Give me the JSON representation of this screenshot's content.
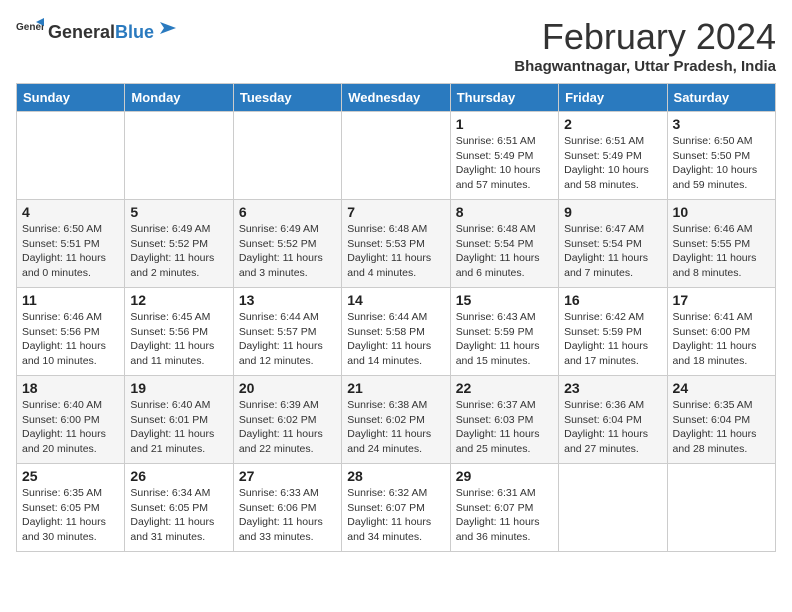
{
  "header": {
    "logo_general": "General",
    "logo_blue": "Blue",
    "title": "February 2024",
    "subtitle": "Bhagwantnagar, Uttar Pradesh, India"
  },
  "weekdays": [
    "Sunday",
    "Monday",
    "Tuesday",
    "Wednesday",
    "Thursday",
    "Friday",
    "Saturday"
  ],
  "weeks": [
    [
      {
        "day": "",
        "info": ""
      },
      {
        "day": "",
        "info": ""
      },
      {
        "day": "",
        "info": ""
      },
      {
        "day": "",
        "info": ""
      },
      {
        "day": "1",
        "info": "Sunrise: 6:51 AM\nSunset: 5:49 PM\nDaylight: 10 hours\nand 57 minutes."
      },
      {
        "day": "2",
        "info": "Sunrise: 6:51 AM\nSunset: 5:49 PM\nDaylight: 10 hours\nand 58 minutes."
      },
      {
        "day": "3",
        "info": "Sunrise: 6:50 AM\nSunset: 5:50 PM\nDaylight: 10 hours\nand 59 minutes."
      }
    ],
    [
      {
        "day": "4",
        "info": "Sunrise: 6:50 AM\nSunset: 5:51 PM\nDaylight: 11 hours\nand 0 minutes."
      },
      {
        "day": "5",
        "info": "Sunrise: 6:49 AM\nSunset: 5:52 PM\nDaylight: 11 hours\nand 2 minutes."
      },
      {
        "day": "6",
        "info": "Sunrise: 6:49 AM\nSunset: 5:52 PM\nDaylight: 11 hours\nand 3 minutes."
      },
      {
        "day": "7",
        "info": "Sunrise: 6:48 AM\nSunset: 5:53 PM\nDaylight: 11 hours\nand 4 minutes."
      },
      {
        "day": "8",
        "info": "Sunrise: 6:48 AM\nSunset: 5:54 PM\nDaylight: 11 hours\nand 6 minutes."
      },
      {
        "day": "9",
        "info": "Sunrise: 6:47 AM\nSunset: 5:54 PM\nDaylight: 11 hours\nand 7 minutes."
      },
      {
        "day": "10",
        "info": "Sunrise: 6:46 AM\nSunset: 5:55 PM\nDaylight: 11 hours\nand 8 minutes."
      }
    ],
    [
      {
        "day": "11",
        "info": "Sunrise: 6:46 AM\nSunset: 5:56 PM\nDaylight: 11 hours\nand 10 minutes."
      },
      {
        "day": "12",
        "info": "Sunrise: 6:45 AM\nSunset: 5:56 PM\nDaylight: 11 hours\nand 11 minutes."
      },
      {
        "day": "13",
        "info": "Sunrise: 6:44 AM\nSunset: 5:57 PM\nDaylight: 11 hours\nand 12 minutes."
      },
      {
        "day": "14",
        "info": "Sunrise: 6:44 AM\nSunset: 5:58 PM\nDaylight: 11 hours\nand 14 minutes."
      },
      {
        "day": "15",
        "info": "Sunrise: 6:43 AM\nSunset: 5:59 PM\nDaylight: 11 hours\nand 15 minutes."
      },
      {
        "day": "16",
        "info": "Sunrise: 6:42 AM\nSunset: 5:59 PM\nDaylight: 11 hours\nand 17 minutes."
      },
      {
        "day": "17",
        "info": "Sunrise: 6:41 AM\nSunset: 6:00 PM\nDaylight: 11 hours\nand 18 minutes."
      }
    ],
    [
      {
        "day": "18",
        "info": "Sunrise: 6:40 AM\nSunset: 6:00 PM\nDaylight: 11 hours\nand 20 minutes."
      },
      {
        "day": "19",
        "info": "Sunrise: 6:40 AM\nSunset: 6:01 PM\nDaylight: 11 hours\nand 21 minutes."
      },
      {
        "day": "20",
        "info": "Sunrise: 6:39 AM\nSunset: 6:02 PM\nDaylight: 11 hours\nand 22 minutes."
      },
      {
        "day": "21",
        "info": "Sunrise: 6:38 AM\nSunset: 6:02 PM\nDaylight: 11 hours\nand 24 minutes."
      },
      {
        "day": "22",
        "info": "Sunrise: 6:37 AM\nSunset: 6:03 PM\nDaylight: 11 hours\nand 25 minutes."
      },
      {
        "day": "23",
        "info": "Sunrise: 6:36 AM\nSunset: 6:04 PM\nDaylight: 11 hours\nand 27 minutes."
      },
      {
        "day": "24",
        "info": "Sunrise: 6:35 AM\nSunset: 6:04 PM\nDaylight: 11 hours\nand 28 minutes."
      }
    ],
    [
      {
        "day": "25",
        "info": "Sunrise: 6:35 AM\nSunset: 6:05 PM\nDaylight: 11 hours\nand 30 minutes."
      },
      {
        "day": "26",
        "info": "Sunrise: 6:34 AM\nSunset: 6:05 PM\nDaylight: 11 hours\nand 31 minutes."
      },
      {
        "day": "27",
        "info": "Sunrise: 6:33 AM\nSunset: 6:06 PM\nDaylight: 11 hours\nand 33 minutes."
      },
      {
        "day": "28",
        "info": "Sunrise: 6:32 AM\nSunset: 6:07 PM\nDaylight: 11 hours\nand 34 minutes."
      },
      {
        "day": "29",
        "info": "Sunrise: 6:31 AM\nSunset: 6:07 PM\nDaylight: 11 hours\nand 36 minutes."
      },
      {
        "day": "",
        "info": ""
      },
      {
        "day": "",
        "info": ""
      }
    ]
  ]
}
